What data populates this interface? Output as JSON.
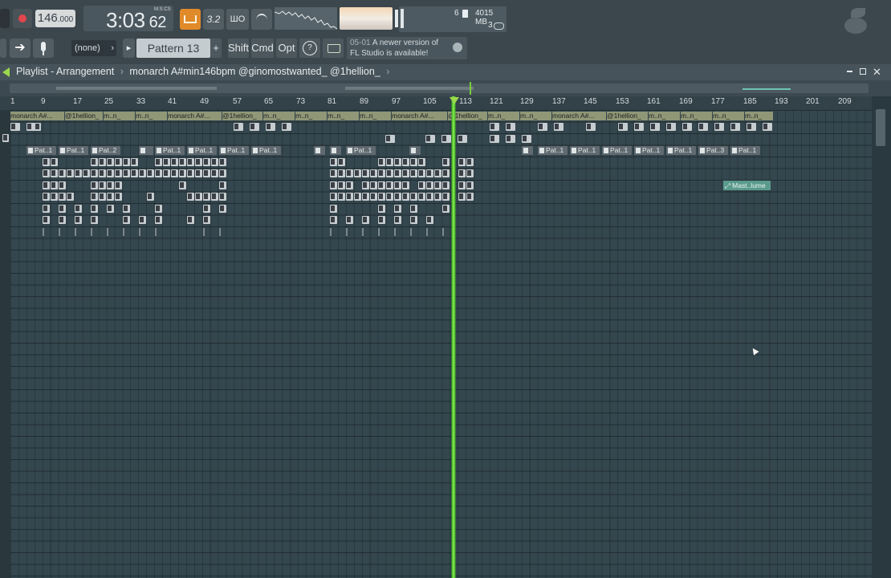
{
  "toolbar": {
    "tempo": "146",
    "tempo_decimal": ".000",
    "song_time": "3:03",
    "song_time_small": "62",
    "song_time_label": "M:S:CS",
    "btn_32": "3.2",
    "btn_wo": "ШО",
    "memory": "4015 MB",
    "cpu": "6",
    "polyphony": "3",
    "midi_device": "(none)",
    "pattern": "Pattern 13",
    "shift": "Shift",
    "cmd": "Cmd",
    "opt": "Opt",
    "news_date": "05-01",
    "news_line1": "A newer version of",
    "news_line2": "FL Studio is available!"
  },
  "playlist": {
    "title": "Playlist - Arrangement",
    "separator": "›",
    "project": "monarch A#min146bpm @ginomostwanted_ @1hellion_",
    "ruler": [
      "1",
      "9",
      "17",
      "25",
      "33",
      "41",
      "49",
      "57",
      "65",
      "73",
      "81",
      "89",
      "97",
      "105",
      "113",
      "121",
      "129",
      "137",
      "145",
      "153",
      "161",
      "169",
      "177",
      "185",
      "193",
      "201",
      "209"
    ],
    "audio_labels": {
      "main": "monarch A#...",
      "hellion": "@1hellion_",
      "short": "m..n_",
      "bar": "@1hellion_"
    },
    "pattern_labels": {
      "p1": "Pat..1",
      "p2": "Pat..2",
      "p3": "Pat..3",
      "blank": ""
    },
    "automation_clip": "Mast..lume"
  },
  "colors": {
    "playhead": "#8ef04b",
    "grid": "#34464e",
    "toolbar": "#3b464d"
  }
}
